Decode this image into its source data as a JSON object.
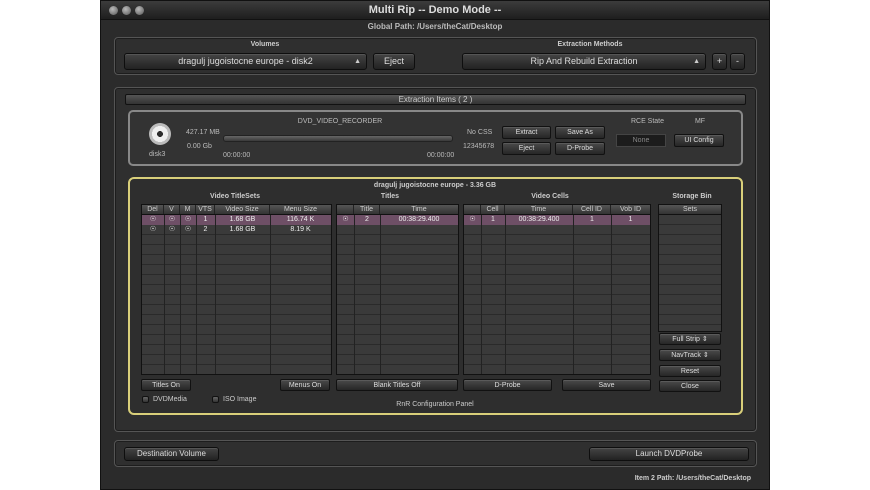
{
  "window": {
    "title": "Multi Rip -- Demo Mode --",
    "global_path": "Global Path: /Users/theCat/Desktop"
  },
  "volumes": {
    "label": "Volumes",
    "selected": "dragulj jugoistocne europe - disk2",
    "eject": "Eject"
  },
  "extraction": {
    "label": "Extraction Methods",
    "selected": "Rip And Rebuild Extraction",
    "plus": "+",
    "minus": "-"
  },
  "items": {
    "title": "Extraction Items ( 2 )"
  },
  "disk": {
    "name": "disk3",
    "size_mb": "427.17 MB",
    "size_gb": "0.00 Gb",
    "recorder": "DVD_VIDEO_RECORDER",
    "time_start": "00:00:00",
    "time_end": "00:00:00",
    "css": "No CSS",
    "serial": "12345678",
    "extract": "Extract",
    "save_as": "Save As",
    "eject": "Eject",
    "dprobe": "D-Probe",
    "rce_label": "RCE State",
    "rce_value": "None",
    "mf_label": "MF",
    "ui_config": "UI Config"
  },
  "rnr": {
    "header": "dragulj jugoistocne europe - 3.36 GB",
    "vts_title": "Video TitleSets",
    "titles_title": "Titles",
    "cells_title": "Video Cells",
    "storage_title": "Storage Bin",
    "vts_cols": [
      "Del",
      "V",
      "M",
      "VTS",
      "Video Size",
      "Menu Size"
    ],
    "vts_rows": [
      {
        "vts": "1",
        "video": "1.68 GB",
        "menu": "116.74 K"
      },
      {
        "vts": "2",
        "video": "1.68 GB",
        "menu": "8.19 K"
      }
    ],
    "titles_cols": [
      "",
      "Title",
      "Time"
    ],
    "titles_rows": [
      {
        "title": "2",
        "time": "00:38:29.400"
      }
    ],
    "cells_cols": [
      "",
      "Cell",
      "Time",
      "Cell ID",
      "Vob ID"
    ],
    "cells_rows": [
      {
        "cell": "1",
        "time": "00:38:29.400",
        "cell_id": "1",
        "vob_id": "1"
      }
    ],
    "storage_cols": [
      "Sets"
    ],
    "titles_on": "Titles On",
    "menus_on": "Menus On",
    "blank_titles_off": "Blank Titles Off",
    "dprobe": "D-Probe",
    "save": "Save",
    "full_strip": "Full Strip",
    "navtrack": "NavTrack",
    "reset": "Reset",
    "close": "Close",
    "dvdmedia": "DVDMedia",
    "iso_image": "ISO Image",
    "panel_label": "RnR Configuration Panel"
  },
  "bottom": {
    "destination": "Destination Volume",
    "launch": "Launch DVDProbe",
    "item_path": "Item 2 Path: /Users/theCat/Desktop"
  }
}
